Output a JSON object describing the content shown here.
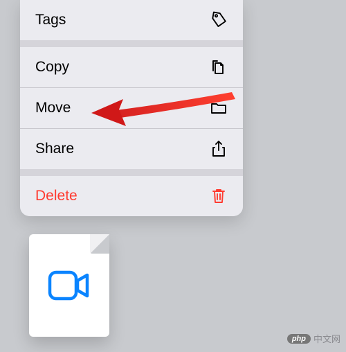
{
  "menu": {
    "items": [
      {
        "label": "Tags",
        "icon": "tag-icon"
      },
      {
        "label": "Copy",
        "icon": "copy-icon"
      },
      {
        "label": "Move",
        "icon": "folder-icon"
      },
      {
        "label": "Share",
        "icon": "share-icon"
      },
      {
        "label": "Delete",
        "icon": "trash-icon",
        "danger": true
      }
    ]
  },
  "file": {
    "icon": "video-icon"
  },
  "watermark": {
    "badge": "php",
    "text": "中文网"
  },
  "colors": {
    "danger": "#ff3b30",
    "accent": "#0a84ff"
  }
}
